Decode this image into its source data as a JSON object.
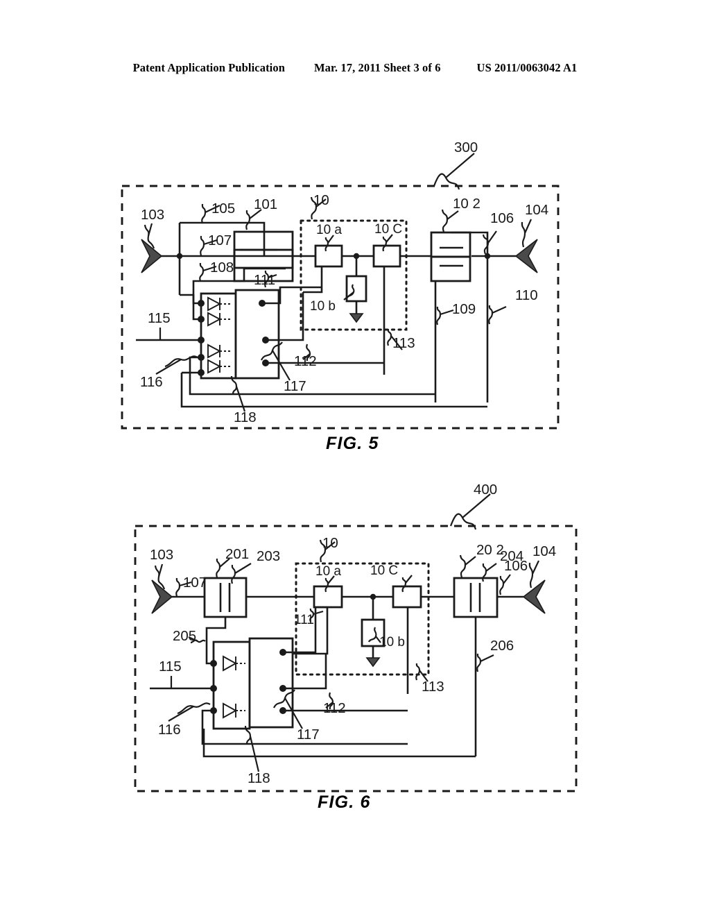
{
  "header": {
    "publication": "Patent Application Publication",
    "date_sheet": "Mar. 17, 2011  Sheet 3 of 6",
    "patent_number": "US 2011/0063042 A1"
  },
  "figures": [
    {
      "id": "fig5",
      "caption": "FIG. 5",
      "system_label": "300",
      "inner_module_label": "10",
      "reference_numerals": [
        "103",
        "105",
        "101",
        "10",
        "10 2",
        "106",
        "104",
        "107",
        "10 a",
        "10 C",
        "108",
        "111",
        "10 b",
        "115",
        "109",
        "110",
        "116",
        "112",
        "113",
        "117",
        "118"
      ],
      "blocks": [
        {
          "name": "coupler-left",
          "label": "101"
        },
        {
          "name": "coupler-right",
          "label": "10 2"
        },
        {
          "name": "module-a",
          "label": "10 a"
        },
        {
          "name": "module-b",
          "label": "10 b"
        },
        {
          "name": "module-c",
          "label": "10 C"
        },
        {
          "name": "diode-array",
          "label": "118"
        },
        {
          "name": "control-block",
          "label": "117"
        }
      ],
      "ports": [
        {
          "name": "port-left",
          "label": "103"
        },
        {
          "name": "port-right",
          "label": "104"
        }
      ]
    },
    {
      "id": "fig6",
      "caption": "FIG. 6",
      "system_label": "400",
      "inner_module_label": "10",
      "reference_numerals": [
        "103",
        "201",
        "203",
        "10",
        "20 2",
        "204",
        "106",
        "104",
        "107",
        "10 a",
        "10 C",
        "111",
        "10 b",
        "205",
        "115",
        "206",
        "116",
        "112",
        "113",
        "117",
        "118"
      ],
      "blocks": [
        {
          "name": "capacitor-left",
          "label": "201"
        },
        {
          "name": "capacitor-right",
          "label": "20 2"
        },
        {
          "name": "module-a",
          "label": "10 a"
        },
        {
          "name": "module-b",
          "label": "10 b"
        },
        {
          "name": "module-c",
          "label": "10 C"
        },
        {
          "name": "diode-array",
          "label": "118"
        },
        {
          "name": "control-block",
          "label": "117"
        }
      ],
      "ports": [
        {
          "name": "port-left",
          "label": "103"
        },
        {
          "name": "port-right",
          "label": "104"
        }
      ]
    }
  ],
  "labels": {
    "n10": "10",
    "n101": "101",
    "n102": "10 2",
    "n103": "103",
    "n104": "104",
    "n105": "105",
    "n106": "106",
    "n107": "107",
    "n108": "108",
    "n109": "109",
    "n110": "110",
    "n111": "111",
    "n112": "112",
    "n113": "113",
    "n115": "115",
    "n116": "116",
    "n117": "117",
    "n118": "118",
    "n10a": "10 a",
    "n10b": "10 b",
    "n10c": "10 C",
    "n201": "201",
    "n202": "20 2",
    "n203": "203",
    "n204": "204",
    "n205": "205",
    "n206": "206",
    "n300": "300",
    "n400": "400"
  },
  "colors": {
    "ink": "#1a1a1a",
    "paper": "#ffffff",
    "fill_triangle": "#4a4a4a"
  }
}
